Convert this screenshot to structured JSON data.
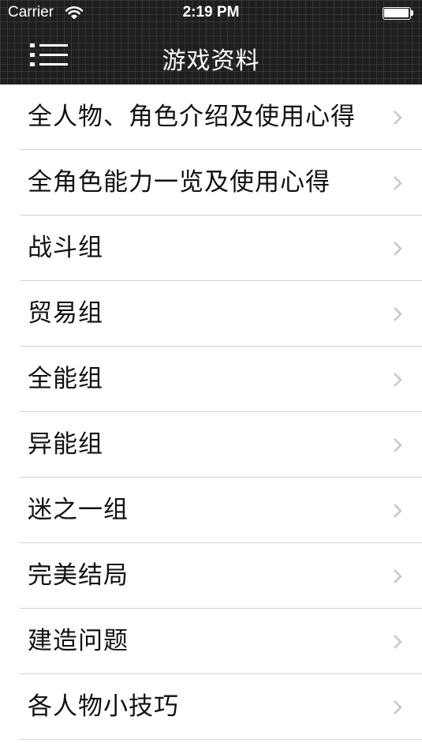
{
  "status_bar": {
    "carrier": "Carrier",
    "time": "2:19 PM"
  },
  "nav": {
    "title": "游戏资料",
    "menu_icon": "hamburger-menu-icon"
  },
  "colors": {
    "header_background": "#1e1e1e",
    "separator": "#d4d4d8",
    "chevron": "#c7c7cc",
    "text": "#111111"
  },
  "list": {
    "items": [
      {
        "label": "全人物、角色介绍及使用心得"
      },
      {
        "label": "全角色能力一览及使用心得"
      },
      {
        "label": "战斗组"
      },
      {
        "label": "贸易组"
      },
      {
        "label": "全能组"
      },
      {
        "label": "异能组"
      },
      {
        "label": "迷之一组"
      },
      {
        "label": "完美结局"
      },
      {
        "label": "建造问题"
      },
      {
        "label": "各人物小技巧"
      }
    ]
  }
}
